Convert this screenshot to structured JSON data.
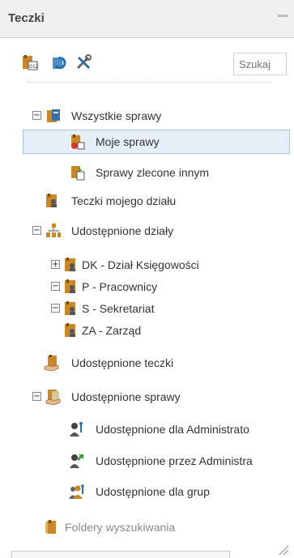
{
  "panel": {
    "title": "Teczki",
    "search_placeholder": "Szukaj"
  },
  "toolbar": {
    "icons": [
      "folder-add-icon",
      "refresh-icon",
      "tools-icon"
    ]
  },
  "tree": {
    "all_cases": "Wszystkie sprawy",
    "my_cases": "Moje sprawy",
    "delegated_cases": "Sprawy zlecone innym",
    "department_folders": "Teczki mojego działu",
    "shared_departments": "Udostępnione działy",
    "dept_dk": "DK - Dział Księgowości",
    "dept_p": "P - Pracownicy",
    "dept_s": "S - Sekretariat",
    "dept_za": "ZA - Zarząd",
    "shared_folders": "Udostępnione teczki",
    "shared_cases": "Udostępnione sprawy",
    "shared_for_admin": "Udostępnione dla Administrato",
    "shared_by_admin": "Udostępnione przez Administra",
    "shared_for_groups": "Udostępnione dla grup",
    "search_folders": "Foldery wyszukiwania"
  },
  "colors": {
    "selection_bg": "#e6eef7",
    "selection_border": "#a9c4e0",
    "folder_orange": "#c8882a"
  }
}
